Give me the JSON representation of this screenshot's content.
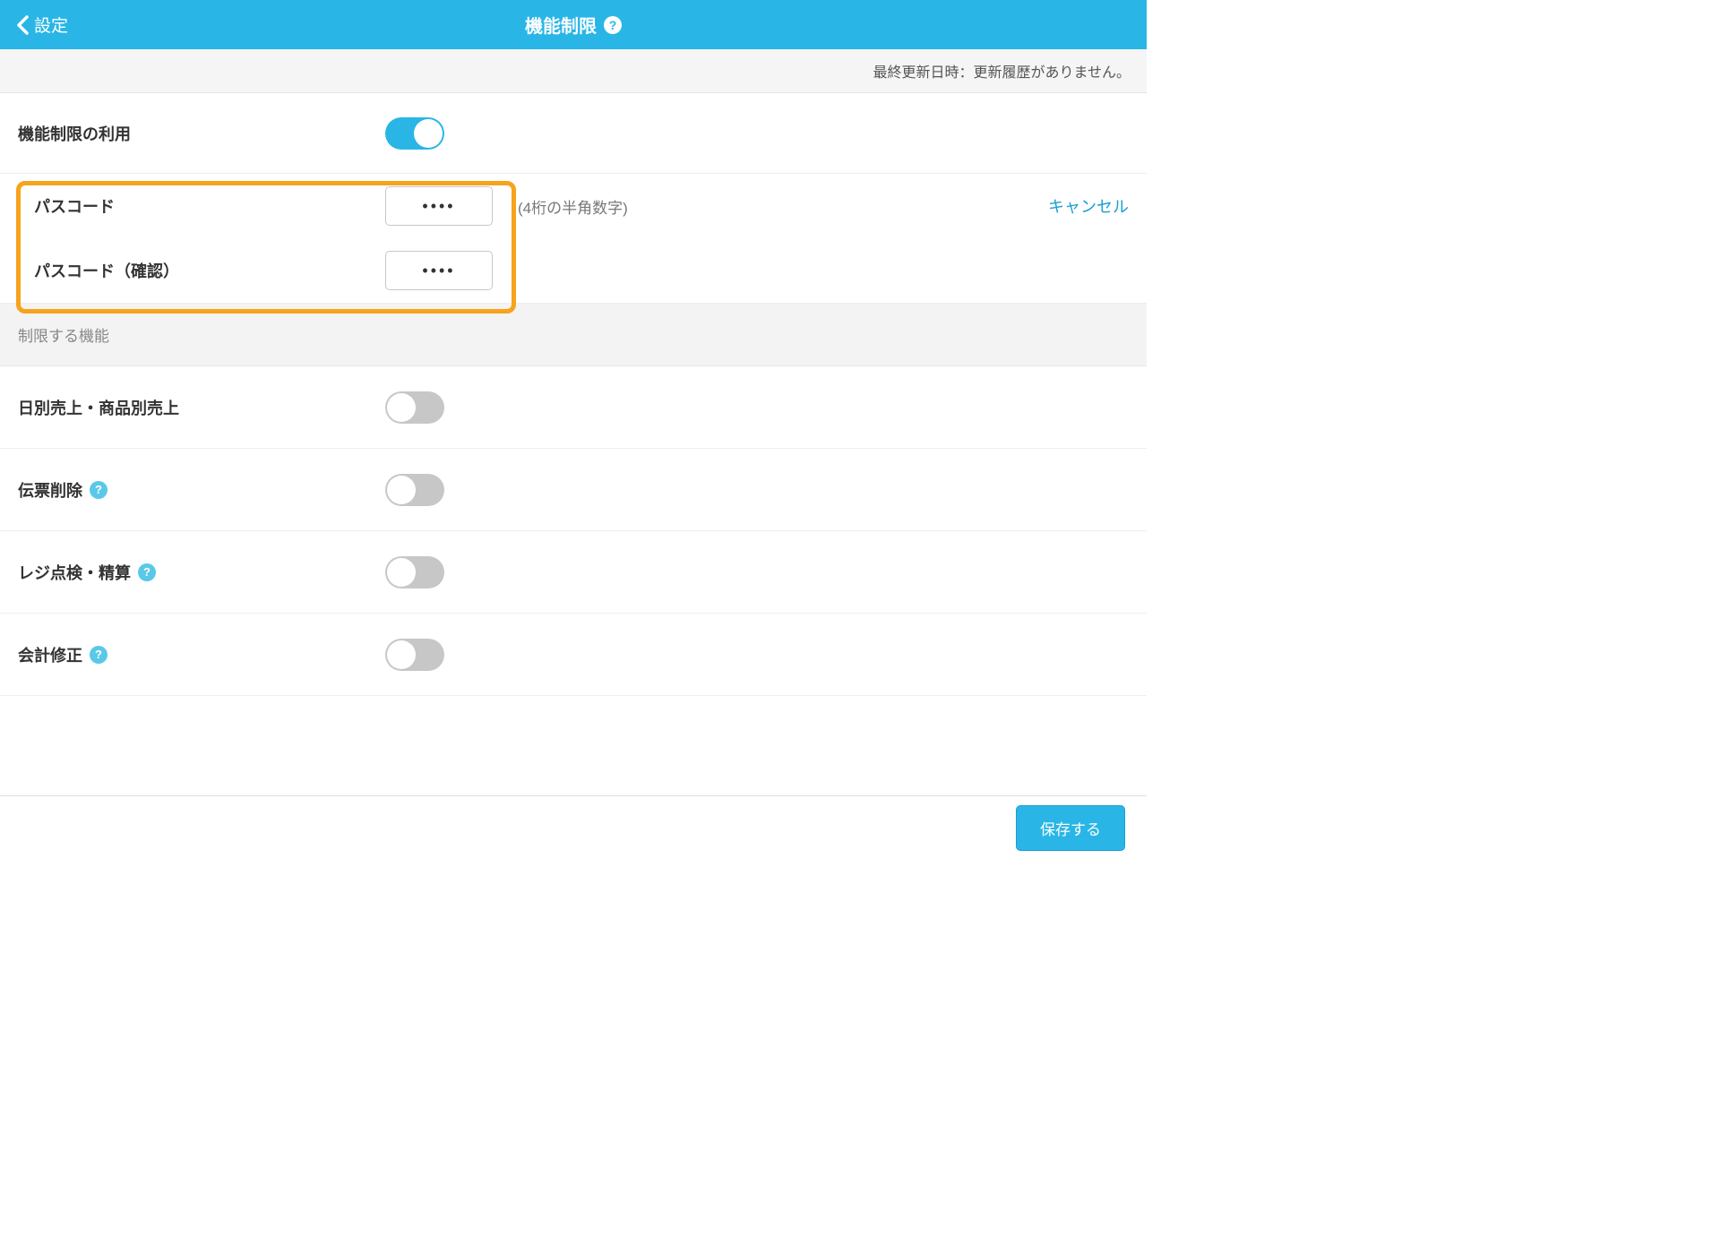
{
  "header": {
    "back_label": "設定",
    "title": "機能制限"
  },
  "updated_text": "最終更新日時：更新履歴がありません。",
  "usage": {
    "label": "機能制限の利用",
    "enabled": true
  },
  "passcode": {
    "label": "パスコード",
    "confirm_label": "パスコード（確認）",
    "value": "0000",
    "confirm_value": "0000",
    "hint": "(4桁の半角数字)",
    "cancel_label": "キャンセル"
  },
  "restrict_header": "制限する機能",
  "features": [
    {
      "label": "日別売上・商品別売上",
      "help": false,
      "enabled": false
    },
    {
      "label": "伝票削除",
      "help": true,
      "enabled": false
    },
    {
      "label": "レジ点検・精算",
      "help": true,
      "enabled": false
    },
    {
      "label": "会計修正",
      "help": true,
      "enabled": false
    }
  ],
  "save_label": "保存する"
}
